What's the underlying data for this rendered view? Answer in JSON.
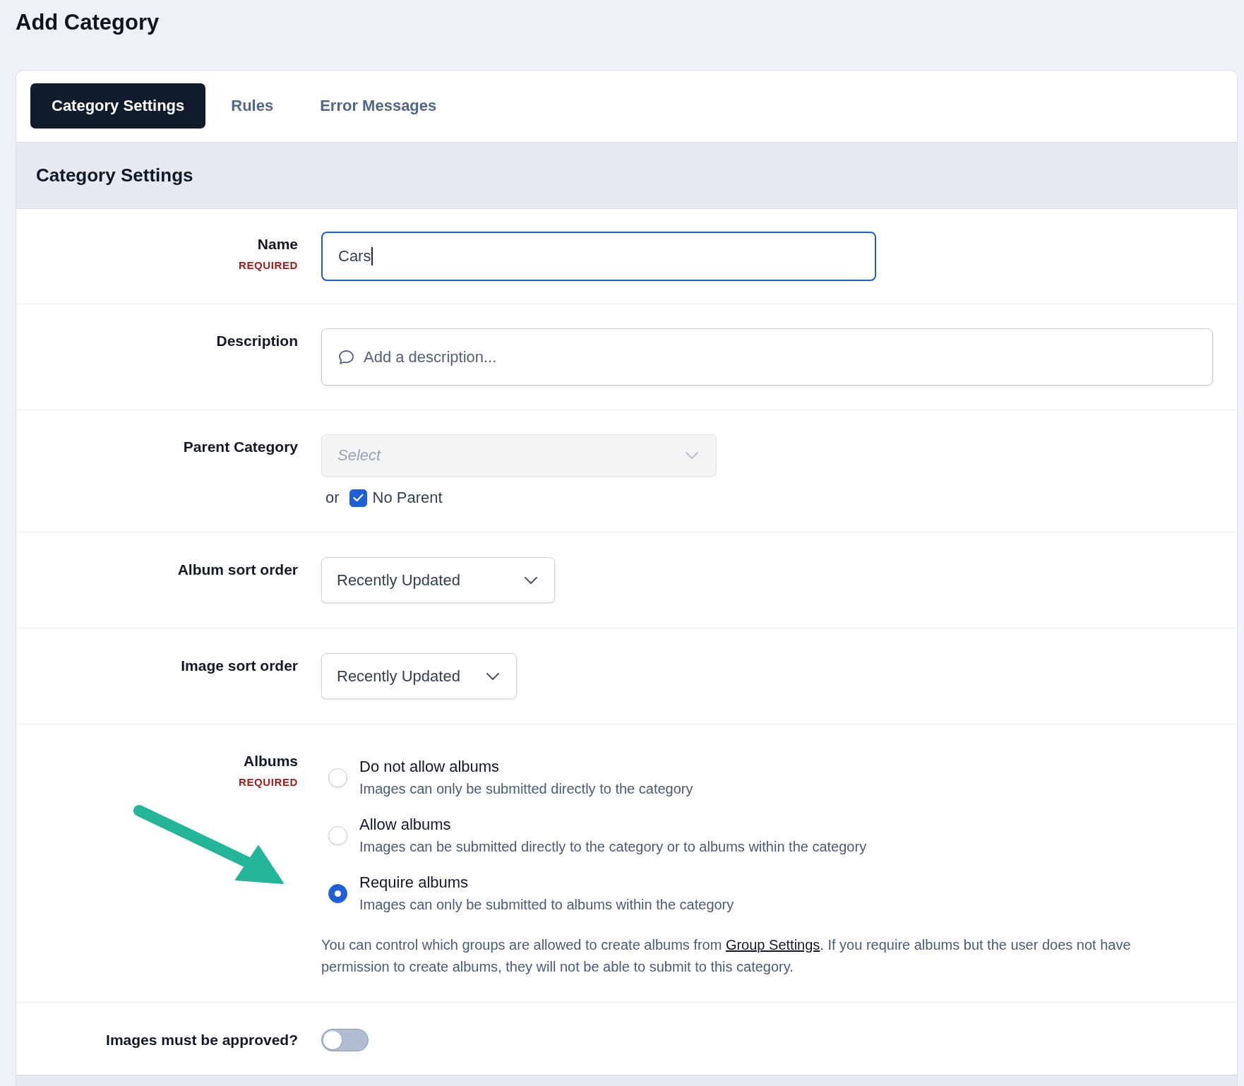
{
  "page": {
    "title": "Add Category"
  },
  "tabs": [
    {
      "label": "Category Settings",
      "selected": true
    },
    {
      "label": "Rules",
      "selected": false
    },
    {
      "label": "Error Messages",
      "selected": false
    }
  ],
  "section": {
    "title": "Category Settings"
  },
  "fields": [
    {
      "kind": "text",
      "label": "Name",
      "required_label": "REQUIRED",
      "value": "Cars",
      "focused": true
    },
    {
      "kind": "textarea",
      "label": "Description",
      "placeholder": "Add a description..."
    },
    {
      "kind": "parent",
      "label": "Parent Category",
      "placeholder": "Select",
      "disabled": true,
      "or_text": "or",
      "checkbox": {
        "label": "No Parent",
        "checked": true
      }
    },
    {
      "kind": "select",
      "label": "Album sort order",
      "value": "Recently Updated"
    },
    {
      "kind": "select",
      "label": "Image sort order",
      "value": "Recently Updated"
    },
    {
      "kind": "radio",
      "label": "Albums",
      "required_label": "REQUIRED",
      "options": [
        {
          "title": "Do not allow albums",
          "description": "Images can only be submitted directly to the category",
          "selected": false
        },
        {
          "title": "Allow albums",
          "description": "Images can be submitted directly to the category or to albums within the category",
          "selected": false
        },
        {
          "title": "Require albums",
          "description": "Images can only be submitted to albums within the category",
          "selected": true
        }
      ],
      "help": {
        "before": "You can control which groups are allowed to create albums from ",
        "link": "Group Settings",
        "after": ". If you require albums but the user does not have permission to create albums, they will not be able to submit to this category."
      }
    },
    {
      "kind": "toggle",
      "label": "Images must be approved?",
      "on": false
    }
  ]
}
